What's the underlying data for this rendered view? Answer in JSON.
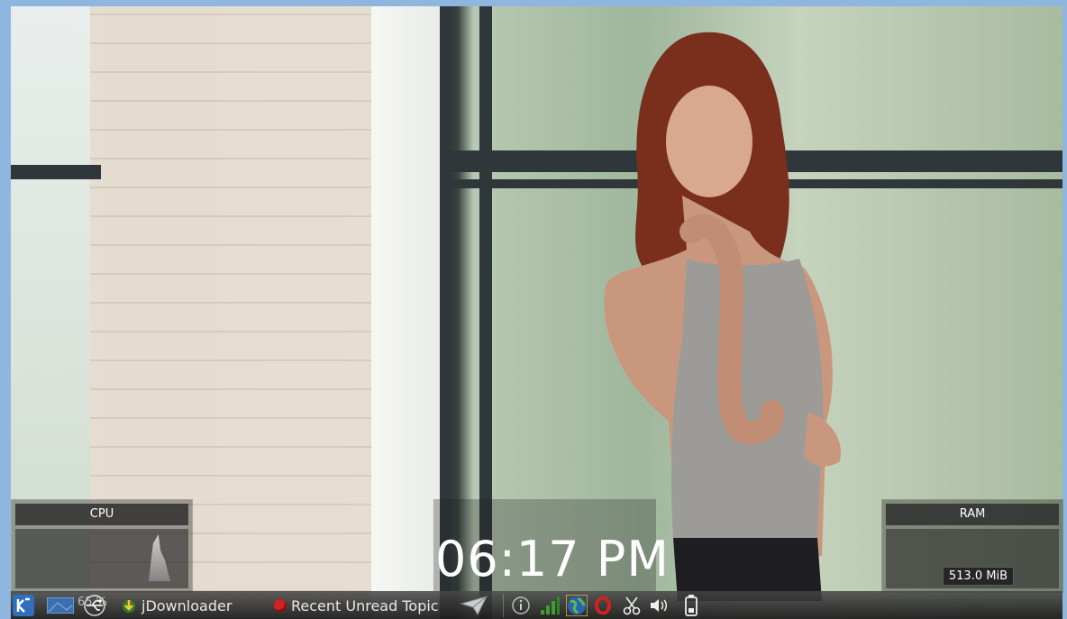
{
  "widgets": {
    "cpu": {
      "title": "CPU"
    },
    "ram": {
      "title": "RAM",
      "value": "513.0 MiB"
    }
  },
  "clock": {
    "time": "06:17 PM"
  },
  "taskbar": {
    "cpu_percent": "65 %",
    "tasks": [
      {
        "label": "jDownloader"
      },
      {
        "label": "Recent Unread Topic"
      }
    ]
  },
  "colors": {
    "accent": "#2f6fc0",
    "opera_red": "#d32020",
    "signal_green": "#3ca02c"
  },
  "icons": [
    "kde-menu-icon",
    "desktop-pager-icon",
    "network-usb-icon",
    "jdownloader-icon",
    "opera-icon",
    "paper-plane-icon",
    "info-icon",
    "signal-strength-icon",
    "globe-icon",
    "opera-tray-icon",
    "scissors-icon",
    "volume-icon",
    "battery-icon"
  ]
}
